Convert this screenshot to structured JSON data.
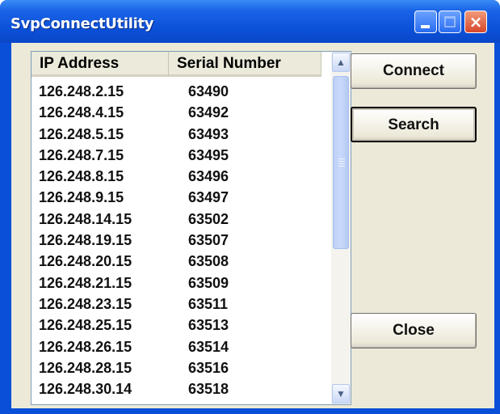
{
  "window": {
    "title": "SvpConnectUtility"
  },
  "title_buttons": {
    "minimize": "minimize",
    "maximize": "maximize",
    "close": "×"
  },
  "list": {
    "columns": [
      "IP Address",
      "Serial Number"
    ],
    "rows": [
      [
        "126.248.2.15",
        "63490"
      ],
      [
        "126.248.4.15",
        "63492"
      ],
      [
        "126.248.5.15",
        "63493"
      ],
      [
        "126.248.7.15",
        "63495"
      ],
      [
        "126.248.8.15",
        "63496"
      ],
      [
        "126.248.9.15",
        "63497"
      ],
      [
        "126.248.14.15",
        "63502"
      ],
      [
        "126.248.19.15",
        "63507"
      ],
      [
        "126.248.20.15",
        "63508"
      ],
      [
        "126.248.21.15",
        "63509"
      ],
      [
        "126.248.23.15",
        "63511"
      ],
      [
        "126.248.25.15",
        "63513"
      ],
      [
        "126.248.26.15",
        "63514"
      ],
      [
        "126.248.28.15",
        "63516"
      ],
      [
        "126.248.30.14",
        "63518"
      ]
    ]
  },
  "buttons": {
    "connect": "Connect",
    "search": "Search",
    "close": "Close"
  },
  "icons": {
    "scroll_up": "▲",
    "scroll_down": "▼"
  }
}
